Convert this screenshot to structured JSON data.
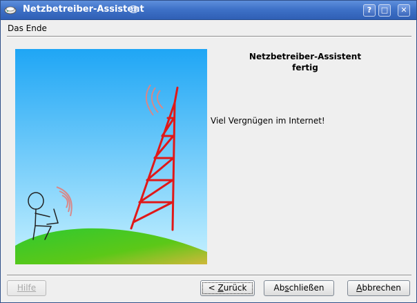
{
  "window": {
    "title": "Netzbetreiber-Assistent",
    "controls": {
      "help": "?",
      "maximize": "□",
      "close": "✕"
    }
  },
  "page": {
    "section_label": "Das Ende",
    "heading_line1": "Netzbetreiber-Assistent",
    "heading_line2": "fertig",
    "message": "Viel Vergnügen im Internet!"
  },
  "buttons": {
    "help": {
      "label": "Hilfe",
      "enabled": false
    },
    "back": {
      "pre": "< ",
      "mnemonic": "Z",
      "post": "urück"
    },
    "finish": {
      "pre": "Ab",
      "mnemonic": "s",
      "post": "chließen"
    },
    "cancel": {
      "pre": "",
      "mnemonic": "A",
      "post": "bbrechen"
    }
  },
  "colors": {
    "titlebar": "#3f72c8",
    "sky_top": "#1fa6f5",
    "sky_bottom": "#c4f0ff",
    "hill": "#3cc82c",
    "tower": "#e01818",
    "signal_waves": "#d88888"
  }
}
